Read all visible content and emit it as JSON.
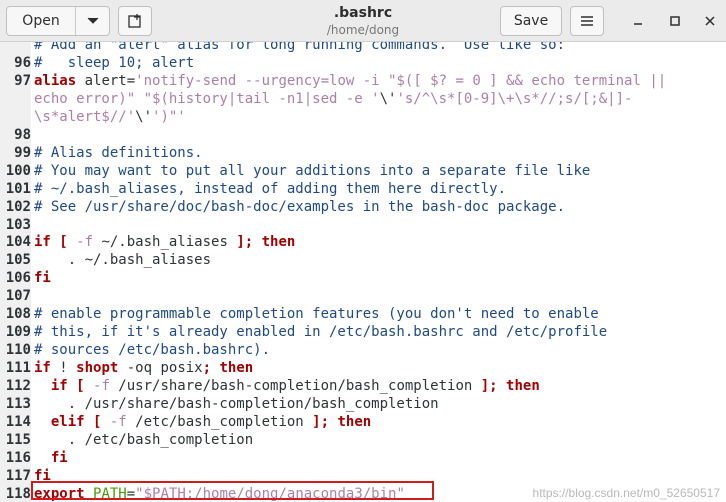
{
  "header": {
    "open_label": "Open",
    "title": ".bashrc",
    "subtitle": "/home/dong",
    "save_label": "Save"
  },
  "lines": [
    {
      "num": "",
      "parts": [
        {
          "t": "# Add an \"alert\" alias for long running commands.  Use like so:",
          "c": "c"
        }
      ]
    },
    {
      "num": "96",
      "parts": [
        {
          "t": "#   sleep 10; alert",
          "c": "c"
        }
      ]
    },
    {
      "num": "97",
      "parts": [
        {
          "t": "alias",
          "c": "k"
        },
        {
          "t": " alert=",
          "c": "d"
        },
        {
          "t": "'notify-send --urgency=low -i \"$([ $? = 0 ] && echo terminal ||",
          "c": "s"
        }
      ]
    },
    {
      "num": "",
      "parts": [
        {
          "t": "echo error)\" \"$(history|tail -n1|sed -e '",
          "c": "s"
        },
        {
          "t": "\\'",
          "c": "d"
        },
        {
          "t": "'s/^\\s*[0-9]\\+\\s*//;s/[;&|]-",
          "c": "s"
        }
      ]
    },
    {
      "num": "",
      "parts": [
        {
          "t": "\\s*alert$//'",
          "c": "s"
        },
        {
          "t": "\\'",
          "c": "d"
        },
        {
          "t": "')\"'",
          "c": "s"
        }
      ]
    },
    {
      "num": "98",
      "parts": []
    },
    {
      "num": "99",
      "parts": [
        {
          "t": "# Alias definitions.",
          "c": "c"
        }
      ]
    },
    {
      "num": "100",
      "parts": [
        {
          "t": "# You may want to put all your additions into a separate file like",
          "c": "c"
        }
      ]
    },
    {
      "num": "101",
      "parts": [
        {
          "t": "# ~/.bash_aliases, instead of adding them here directly.",
          "c": "c"
        }
      ]
    },
    {
      "num": "102",
      "parts": [
        {
          "t": "# See /usr/share/doc/bash-doc/examples in the bash-doc package.",
          "c": "c"
        }
      ]
    },
    {
      "num": "103",
      "parts": []
    },
    {
      "num": "104",
      "parts": [
        {
          "t": "if",
          "c": "k"
        },
        {
          "t": " [ ",
          "c": "k"
        },
        {
          "t": "-f",
          "c": "s"
        },
        {
          "t": " ~/.bash_aliases ",
          "c": "d"
        },
        {
          "t": "]; then",
          "c": "k"
        }
      ]
    },
    {
      "num": "105",
      "parts": [
        {
          "t": "    . ~/.bash_aliases",
          "c": "d"
        }
      ]
    },
    {
      "num": "106",
      "parts": [
        {
          "t": "fi",
          "c": "k"
        }
      ]
    },
    {
      "num": "107",
      "parts": []
    },
    {
      "num": "108",
      "parts": [
        {
          "t": "# enable programmable completion features (you don't need to enable",
          "c": "c"
        }
      ]
    },
    {
      "num": "109",
      "parts": [
        {
          "t": "# this, if it's already enabled in /etc/bash.bashrc and /etc/profile",
          "c": "c"
        }
      ]
    },
    {
      "num": "110",
      "parts": [
        {
          "t": "# sources /etc/bash.bashrc).",
          "c": "c"
        }
      ]
    },
    {
      "num": "111",
      "parts": [
        {
          "t": "if",
          "c": "k"
        },
        {
          "t": " ! ",
          "c": "d"
        },
        {
          "t": "shopt",
          "c": "k"
        },
        {
          "t": " -oq posix",
          "c": "d"
        },
        {
          "t": "; then",
          "c": "k"
        }
      ]
    },
    {
      "num": "112",
      "parts": [
        {
          "t": "  if",
          "c": "k"
        },
        {
          "t": " [ ",
          "c": "k"
        },
        {
          "t": "-f",
          "c": "s"
        },
        {
          "t": " /usr/share/bash-completion/bash_completion ",
          "c": "d"
        },
        {
          "t": "]; then",
          "c": "k"
        }
      ]
    },
    {
      "num": "113",
      "parts": [
        {
          "t": "    . /usr/share/bash-completion/bash_completion",
          "c": "d"
        }
      ]
    },
    {
      "num": "114",
      "parts": [
        {
          "t": "  elif",
          "c": "k"
        },
        {
          "t": " [ ",
          "c": "k"
        },
        {
          "t": "-f",
          "c": "s"
        },
        {
          "t": " /etc/bash_completion ",
          "c": "d"
        },
        {
          "t": "]; then",
          "c": "k"
        }
      ]
    },
    {
      "num": "115",
      "parts": [
        {
          "t": "    . /etc/bash_completion",
          "c": "d"
        }
      ]
    },
    {
      "num": "116",
      "parts": [
        {
          "t": "  fi",
          "c": "k"
        }
      ]
    },
    {
      "num": "117",
      "parts": [
        {
          "t": "fi",
          "c": "k"
        }
      ]
    },
    {
      "num": "118",
      "parts": [
        {
          "t": "export",
          "c": "k"
        },
        {
          "t": " ",
          "c": "d"
        },
        {
          "t": "PATH",
          "c": "v"
        },
        {
          "t": "=",
          "c": "d"
        },
        {
          "t": "\"$PATH:/home/dong/anaconda3/bin\"",
          "c": "s"
        }
      ]
    }
  ],
  "watermark": "https://blog.csdn.net/m0_52650517"
}
